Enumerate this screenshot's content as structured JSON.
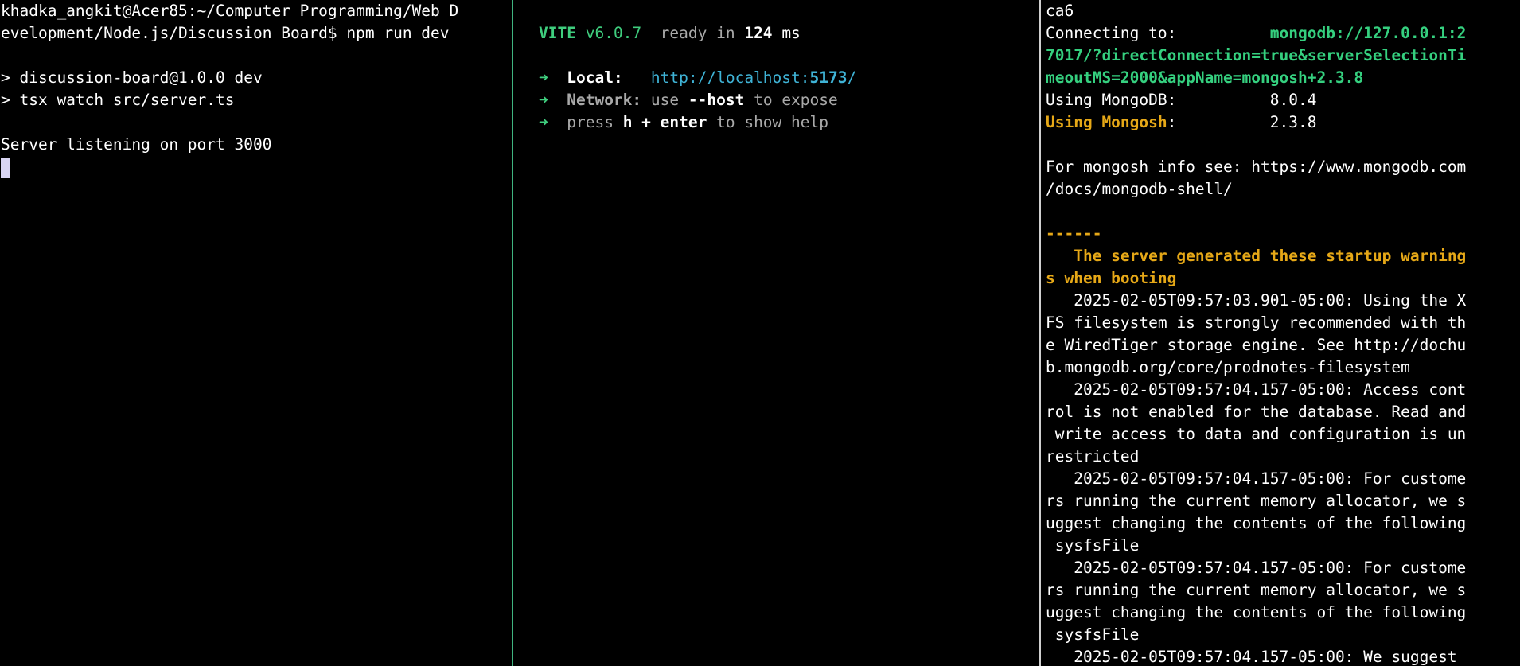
{
  "colors": {
    "vite_green": "#3fce7e",
    "link_cyan": "#3fb3d6",
    "warning_yellow": "#e6a817",
    "mongo_uri_green": "#35d07f",
    "divider_green": "#3fb37f",
    "cursor": "#d8d4f2"
  },
  "left": {
    "prompt_line1": "khadka_angkit@Acer85:~/Computer Programming/Web D",
    "prompt_line2": "evelopment/Node.js/Discussion Board$ npm run dev",
    "script_line1": "> discussion-board@1.0.0 dev",
    "script_line2": "> tsx watch src/server.ts",
    "server_status": "Server listening on port 3000"
  },
  "mid": {
    "vite_name": "VITE",
    "vite_version": "v6.0.7",
    "ready_text": "ready in",
    "ready_ms": "124",
    "ms_unit": "ms",
    "arrow": "➜",
    "local_label": "Local:",
    "local_url_prefix": "http://localhost:",
    "local_port": "5173",
    "local_url_suffix": "/",
    "network_label": "Network:",
    "network_use": "use",
    "network_flag": "--host",
    "network_rest": "to expose",
    "press_text": "press",
    "press_keys": "h + enter",
    "press_rest": "to show help"
  },
  "right": {
    "line_ca6": "ca6",
    "connecting_label": "Connecting to:",
    "connecting_gap": "          ",
    "uri_part1": "mongodb://127.0.0.1:2",
    "uri_part2": "7017/?directConnection=true&serverSelectionTi",
    "uri_part3": "meoutMS=2000&appName=mongosh+2.3.8",
    "using_mongodb_label": "Using MongoDB:",
    "using_mongodb_gap": "          ",
    "using_mongodb_version": "8.0.4",
    "using_mongosh_label": "Using Mongosh",
    "using_mongosh_colon": ":",
    "using_mongosh_gap": "          ",
    "using_mongosh_version": "2.3.8",
    "info_line1": "For mongosh info see: https://www.mongodb.com",
    "info_line2": "/docs/mongodb-shell/",
    "dashes": "------",
    "warn_header1": "   The server generated these startup warning",
    "warn_header2": "s when booting",
    "w1_l1": "   2025-02-05T09:57:03.901-05:00: Using the X",
    "w1_l2": "FS filesystem is strongly recommended with th",
    "w1_l3": "e WiredTiger storage engine. See http://dochu",
    "w1_l4": "b.mongodb.org/core/prodnotes-filesystem",
    "w2_l1": "   2025-02-05T09:57:04.157-05:00: Access cont",
    "w2_l2": "rol is not enabled for the database. Read and",
    "w2_l3": " write access to data and configuration is un",
    "w2_l4": "restricted",
    "w3_l1": "   2025-02-05T09:57:04.157-05:00: For custome",
    "w3_l2": "rs running the current memory allocator, we s",
    "w3_l3": "uggest changing the contents of the following",
    "w3_l4": " sysfsFile",
    "w4_l1": "   2025-02-05T09:57:04.157-05:00: For custome",
    "w4_l2": "rs running the current memory allocator, we s",
    "w4_l3": "uggest changing the contents of the following",
    "w4_l4": " sysfsFile",
    "w5_l1": "   2025-02-05T09:57:04.157-05:00: We suggest"
  }
}
